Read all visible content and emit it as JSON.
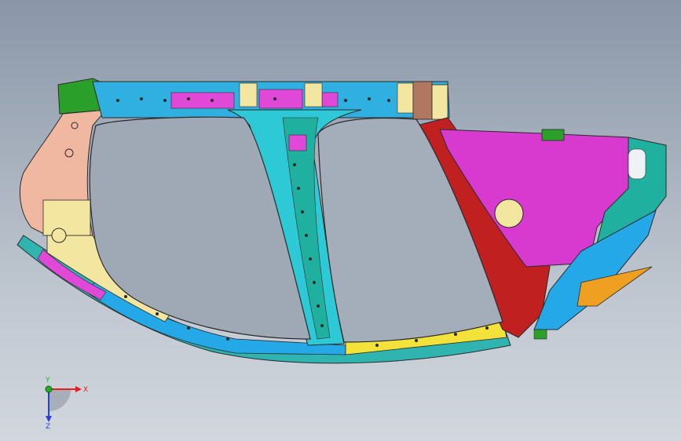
{
  "viewport": {
    "model_name": "vehicle-side-body-frame",
    "colors": {
      "background_top": "#8a96a8",
      "background_bottom": "#d2d7de",
      "roof_rail": "#2fb0e0",
      "roof_rail_inner": "#e048d8",
      "b_pillar": "#2ec9d6",
      "a_pillar_base": "#f0b8a0",
      "front_reinforcement": "#f2e6a0",
      "rear_quarter": "#d83ad0",
      "rear_wheel_arch": "#c02020",
      "rocker_yellow": "#f2e23a",
      "rocker_blue": "#24a8e8",
      "green_bracket": "#2aa02a",
      "teal_panel": "#20b0a0",
      "orange_strip": "#f0a020",
      "outline": "#2a2a2a"
    }
  },
  "triad": {
    "x_label": "X",
    "y_label": "Y",
    "z_label": "Z",
    "x_color": "#e02020",
    "y_color": "#20b020",
    "z_color": "#2040e0"
  }
}
